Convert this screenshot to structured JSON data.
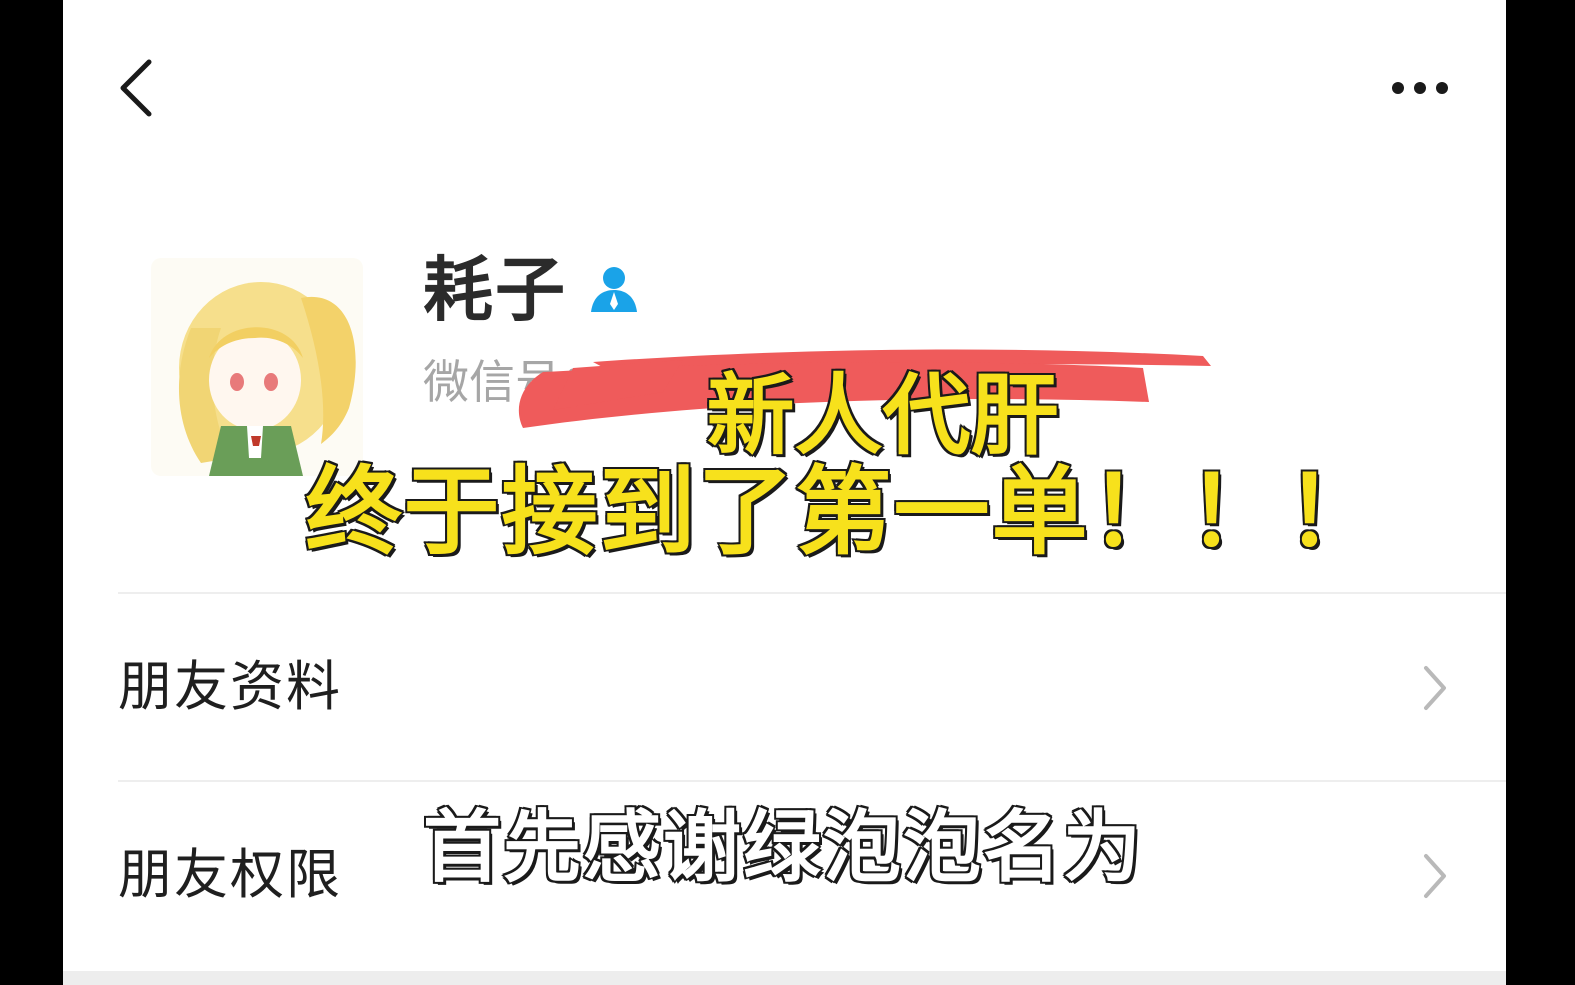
{
  "profile": {
    "name": "耗子",
    "wechat_id_label": "微信号："
  },
  "overlay": {
    "line1": "新人代肝",
    "line2": "终于接到了第一单！！！"
  },
  "menu": {
    "items": [
      {
        "label": "朋友资料"
      },
      {
        "label": "朋友权限"
      }
    ]
  },
  "subtitle": {
    "text": "首先感谢绿泡泡名为"
  },
  "icons": {
    "back": "chevron-left-icon",
    "more": "more-dots-icon",
    "badge": "user-icon",
    "row_arrow": "chevron-right-icon"
  },
  "colors": {
    "badge": "#1aa3e8",
    "redact": "#ef5b5b",
    "overlay_text": "#f7e11c",
    "chevron": "#b9b9b9"
  }
}
